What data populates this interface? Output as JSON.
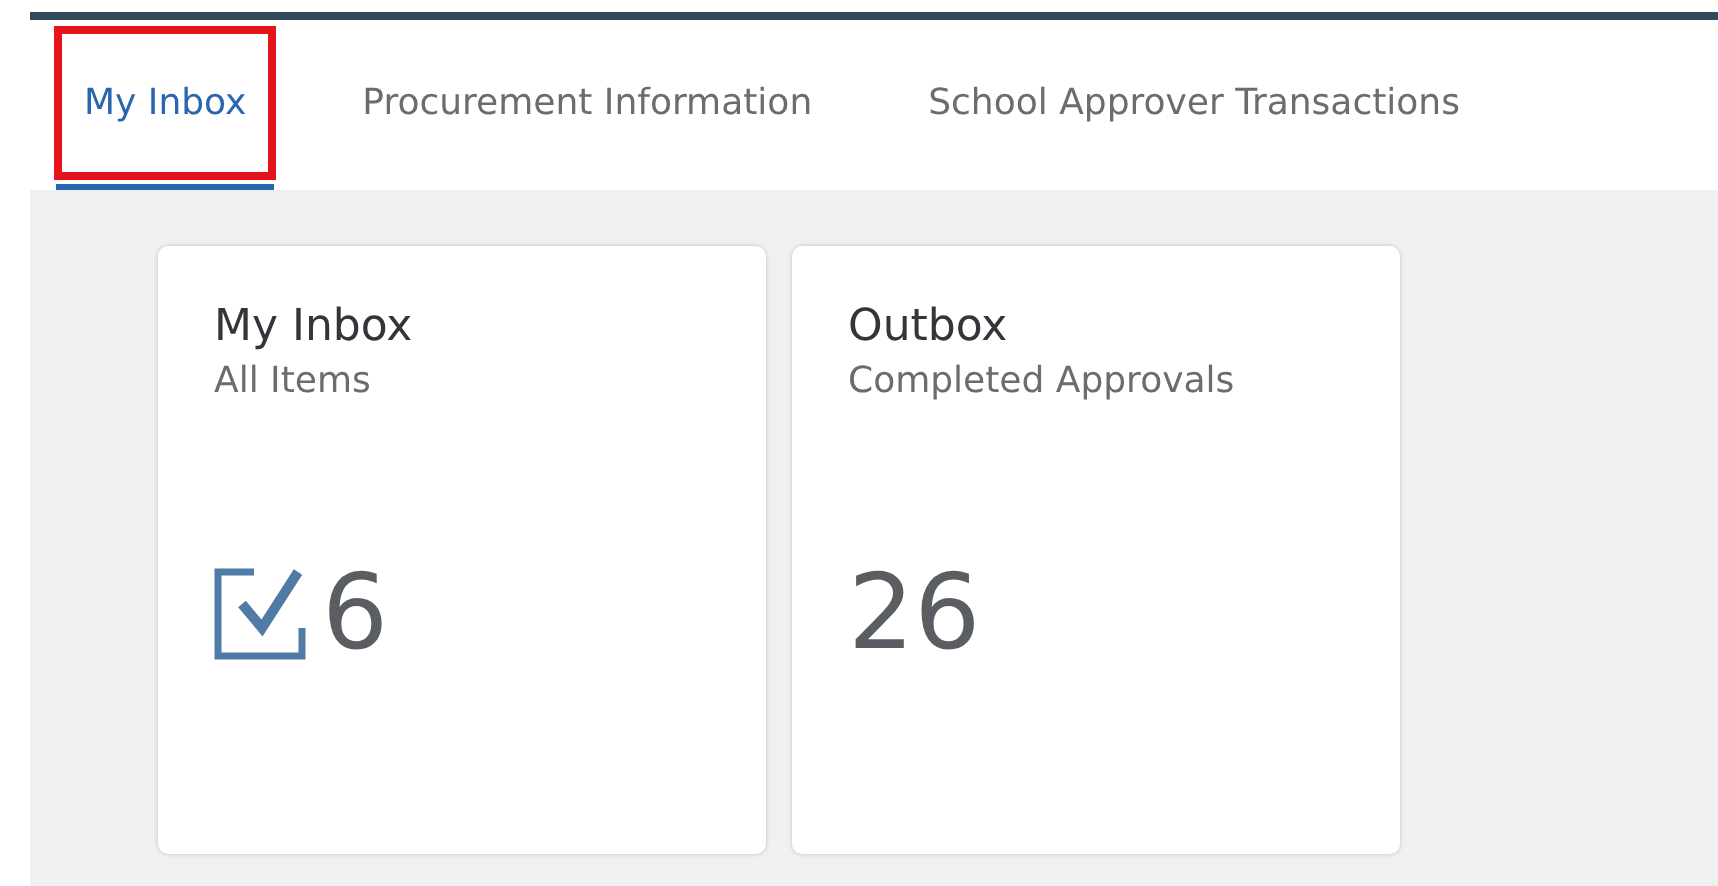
{
  "tabs": [
    {
      "label": "My Inbox",
      "selected": true,
      "highlighted": true
    },
    {
      "label": "Procurement Information",
      "selected": false,
      "highlighted": false
    },
    {
      "label": "School Approver Transactions",
      "selected": false,
      "highlighted": false
    }
  ],
  "tiles": [
    {
      "title": "My Inbox",
      "subtitle": "All Items",
      "kind": "task-count",
      "count": "6"
    },
    {
      "title": "Outbox",
      "subtitle": "Completed Approvals",
      "kind": "count",
      "count": "26"
    }
  ]
}
